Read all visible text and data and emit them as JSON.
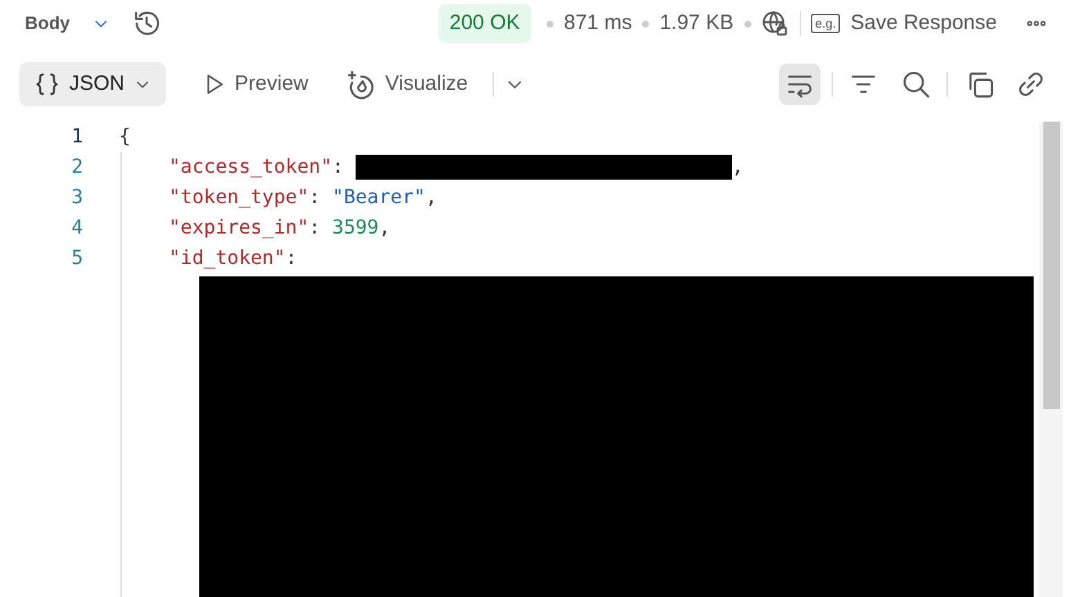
{
  "header": {
    "section": "Body",
    "status": "200 OK",
    "time": "871 ms",
    "size": "1.97 KB",
    "example_badge": "e.g.",
    "save_label": "Save Response"
  },
  "view_tabs": [
    {
      "label": "JSON",
      "selected": true,
      "kind": "format"
    },
    {
      "label": "Preview",
      "selected": false,
      "kind": "preview"
    },
    {
      "label": "Visualize",
      "selected": false,
      "kind": "visualize"
    }
  ],
  "tools": [
    {
      "kind": "wrap",
      "selected": true
    },
    {
      "kind": "filter",
      "selected": false
    },
    {
      "kind": "search",
      "selected": false
    },
    {
      "kind": "copy",
      "selected": false
    },
    {
      "kind": "link",
      "selected": false
    }
  ],
  "code": [
    {
      "number": "1",
      "active": true,
      "tokens": [
        {
          "kind": "punct",
          "text": "{"
        }
      ]
    },
    {
      "number": "2",
      "active": false,
      "tokens": [
        {
          "kind": "key",
          "text": "\"access_token\""
        },
        {
          "kind": "punct",
          "text": ": "
        },
        {
          "kind": "redacted"
        },
        {
          "kind": "punct",
          "text": ","
        }
      ]
    },
    {
      "number": "3",
      "active": false,
      "tokens": [
        {
          "kind": "key",
          "text": "\"token_type\""
        },
        {
          "kind": "punct",
          "text": ": "
        },
        {
          "kind": "string",
          "text": "\"Bearer\""
        },
        {
          "kind": "punct",
          "text": ","
        }
      ]
    },
    {
      "number": "4",
      "active": false,
      "tokens": [
        {
          "kind": "key",
          "text": "\"expires_in\""
        },
        {
          "kind": "punct",
          "text": ": "
        },
        {
          "kind": "number",
          "text": "3599"
        },
        {
          "kind": "punct",
          "text": ","
        }
      ]
    },
    {
      "number": "5",
      "active": false,
      "tokens": [
        {
          "kind": "key",
          "text": "\"id_token\""
        },
        {
          "kind": "punct",
          "text": ":"
        },
        {
          "kind": "redacted-block"
        }
      ]
    }
  ]
}
